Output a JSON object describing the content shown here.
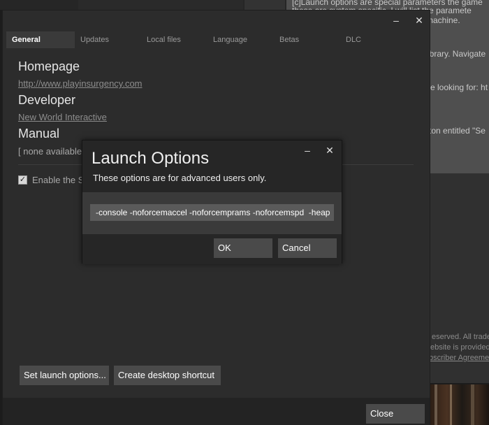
{
  "background": {
    "article_lines": [
      "[c]Launch options are special parameters the game",
      "these are system specific. I will list the paramete",
      "ific machine.",
      "ibrary. Navigate",
      "e looking for: ht",
      "ton entitled \"Se"
    ],
    "footer_lines": [
      "eserved. All trade",
      "ebsite is provided",
      "bscriber Agreeme"
    ]
  },
  "properties": {
    "window_controls": {
      "minimize": "–",
      "close": "✕"
    },
    "tabs": [
      {
        "label": "General",
        "active": true
      },
      {
        "label": "Updates",
        "active": false
      },
      {
        "label": "Local files",
        "active": false
      },
      {
        "label": "Language",
        "active": false
      },
      {
        "label": "Betas",
        "active": false
      },
      {
        "label": "DLC",
        "active": false
      }
    ],
    "general": {
      "homepage_title": "Homepage",
      "homepage_link": "http://www.playinsurgency.com",
      "developer_title": "Developer",
      "developer_link": "New World Interactive",
      "manual_title": "Manual",
      "manual_value": "[ none available ]",
      "checkbox_label": "Enable the S",
      "checkbox_checked": true,
      "checkbox_mark": "✓"
    },
    "buttons": {
      "set_launch": "Set launch options...",
      "desktop_shortcut": "Create desktop shortcut",
      "close": "Close"
    }
  },
  "launch_dialog": {
    "title": "Launch Options",
    "subtitle": "These options are for advanced users only.",
    "input_value": "-console -noforcemaccel -noforcemprams -noforcemspd  -heap",
    "ok_label": "OK",
    "cancel_label": "Cancel",
    "window_controls": {
      "minimize": "–",
      "close": "✕"
    }
  }
}
